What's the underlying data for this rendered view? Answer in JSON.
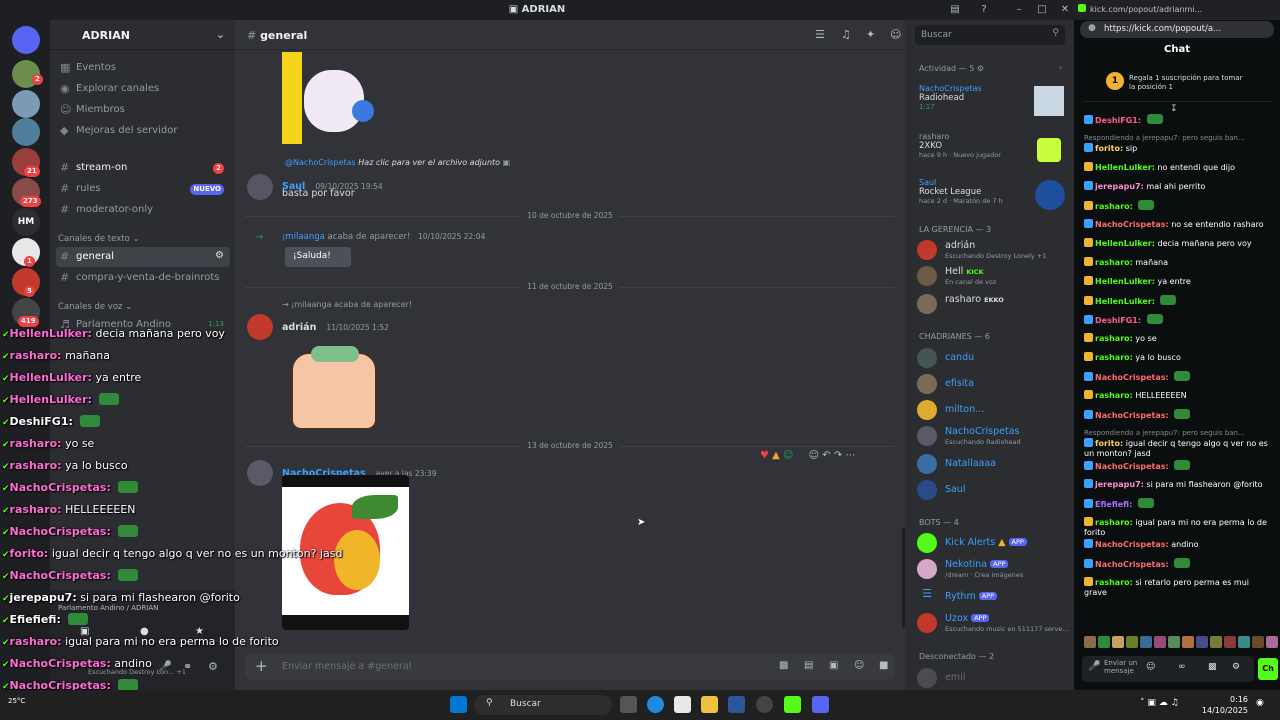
{
  "window": {
    "title": "ADRIAN"
  },
  "server": {
    "name": "ADRIAN"
  },
  "rail_badges": [
    "2",
    "21",
    "273",
    "HM",
    "1",
    "5",
    "419"
  ],
  "sidebar": {
    "top_items": [
      "Eventos",
      "Explorar canales",
      "Miembros",
      "Mejoras del servidor"
    ],
    "channels": [
      {
        "name": "stream-on",
        "badge": "2"
      },
      {
        "name": "rules",
        "badge": "NUEVO"
      },
      {
        "name": "moderator-only",
        "badge": ""
      }
    ],
    "text_category": "Canales de texto",
    "text_channels": [
      "general",
      "compra-y-venta-de-brainrots"
    ],
    "voice_category": "Canales de voz",
    "voice_channels": [
      "Parlamento Andino"
    ],
    "voice_time": "1:13"
  },
  "chat": {
    "channel": "general",
    "attachment_user": "@NachoCrispetas",
    "attachment_text": "Haz clic para ver el archivo adjunto",
    "msg1": {
      "author": "Saul",
      "time": "09/10/2025 19:54",
      "text": "basta por favor"
    },
    "div1": "10 de octubre de 2025",
    "join1": {
      "user": "¡milaanga",
      "text": "acaba de aparecer!",
      "time": "10/10/2025 22:04",
      "button": "¡Saluda!"
    },
    "div2": "11 de octubre de 2025",
    "join2": {
      "user": "¡milaanga",
      "text": "acaba de aparecer!"
    },
    "msg2": {
      "author": "adrián",
      "time": "11/10/2025 1:52"
    },
    "div3": "13 de octubre de 2025",
    "msg3": {
      "author": "NachoCrispetas",
      "time": "ayer a las 23:39"
    },
    "input_placeholder": "Enviar mensaje a #general"
  },
  "members": {
    "search_placeholder": "Buscar",
    "activity_header": "Actividad — 5",
    "activities": [
      {
        "user": "NachoCrispetas",
        "game": "Radiohead",
        "detail": "1:17"
      },
      {
        "user": "rasharo",
        "game": "2XKO",
        "detail": "hace 9 h · Nuevo jugador"
      },
      {
        "user": "Saul",
        "game": "Rocket League",
        "detail": "hace 2 d · Maratón de 7 h"
      }
    ],
    "group1": "LA GERENCIA — 3",
    "gerencia": [
      {
        "name": "adrián",
        "status": "Escuchando Destroy Lonely +1",
        "tag": "",
        "color": "#dbdee1"
      },
      {
        "name": "Hell",
        "status": "En canal de voz",
        "tag": "KICK",
        "color": "#dbdee1"
      },
      {
        "name": "rasharo",
        "status": "",
        "tag": "EKKO",
        "color": "#dbdee1"
      }
    ],
    "group2": "CHADRIANES — 6",
    "chadrianes": [
      {
        "name": "candu",
        "status": "",
        "color": "#3ba0ff"
      },
      {
        "name": "efisita",
        "status": "",
        "color": "#3ba0ff"
      },
      {
        "name": "milton...",
        "status": "",
        "color": "#3ba0ff"
      },
      {
        "name": "NachoCrispetas",
        "status": "Escuchando Radiohead",
        "color": "#3ba0ff"
      },
      {
        "name": "Natallaaaa",
        "status": "",
        "color": "#3ba0ff"
      },
      {
        "name": "Saul",
        "status": "",
        "color": "#3ba0ff"
      }
    ],
    "group3": "BOTS — 4",
    "bots": [
      {
        "name": "Kick Alerts",
        "status": "",
        "tag": "APP"
      },
      {
        "name": "Nekotina",
        "status": "/dream · Crea imágenes",
        "tag": "APP"
      },
      {
        "name": "Rythm",
        "status": "",
        "tag": "APP"
      },
      {
        "name": "Uzox",
        "status": "Escuchando music en 511177 serve...",
        "tag": "APP"
      }
    ],
    "group4": "Desconectado — 2",
    "offline": [
      "emil"
    ]
  },
  "kick": {
    "tab": "kick.com/popout/adrianmi...",
    "url": "https://kick.com/popout/a...",
    "chat_title": "Chat",
    "sub_banner": "Regala 1 suscripción para tomar la posición 1",
    "sub_rank": "1",
    "messages": [
      {
        "u": "DeshiFG1:",
        "t": "",
        "c": "#ff5c8a",
        "reply": ""
      },
      {
        "u": "forito:",
        "t": "sip",
        "c": "#ffd35b",
        "reply": "Respondiendo a jerepapu7: pero seguis ban..."
      },
      {
        "u": "HellenLulker:",
        "t": "no entendi que dijo",
        "c": "#53fc18",
        "reply": ""
      },
      {
        "u": "jerepapu7:",
        "t": "mal ahi perrito",
        "c": "#ff8cd1",
        "reply": ""
      },
      {
        "u": "rasharo:",
        "t": "",
        "c": "#53fc18",
        "reply": ""
      },
      {
        "u": "NachoCrispetas:",
        "t": "no se entendio rasharo",
        "c": "#ff6b6b",
        "reply": ""
      },
      {
        "u": "HellenLulker:",
        "t": "decia mañana pero voy",
        "c": "#53fc18",
        "reply": ""
      },
      {
        "u": "rasharo:",
        "t": "mañana",
        "c": "#53fc18",
        "reply": ""
      },
      {
        "u": "HellenLulker:",
        "t": "ya entre",
        "c": "#53fc18",
        "reply": ""
      },
      {
        "u": "HellenLulker:",
        "t": "",
        "c": "#53fc18",
        "reply": ""
      },
      {
        "u": "DeshiFG1:",
        "t": "",
        "c": "#ff5c8a",
        "reply": ""
      },
      {
        "u": "rasharo:",
        "t": "yo se",
        "c": "#53fc18",
        "reply": ""
      },
      {
        "u": "rasharo:",
        "t": "ya lo busco",
        "c": "#53fc18",
        "reply": ""
      },
      {
        "u": "NachoCrispetas:",
        "t": "",
        "c": "#ff6b6b",
        "reply": ""
      },
      {
        "u": "rasharo:",
        "t": "HELLEEEEEN",
        "c": "#53fc18",
        "reply": ""
      },
      {
        "u": "NachoCrispetas:",
        "t": "",
        "c": "#ff6b6b",
        "reply": ""
      },
      {
        "u": "forito:",
        "t": "igual decir q tengo algo q ver no es un monton? jasd",
        "c": "#ffd35b",
        "reply": "Respondiendo a jerepapu7: pero seguis ban..."
      },
      {
        "u": "NachoCrispetas:",
        "t": "",
        "c": "#ff6b6b",
        "reply": ""
      },
      {
        "u": "jerepapu7:",
        "t": "si para mi flashearon @forito",
        "c": "#ff8cd1",
        "reply": ""
      },
      {
        "u": "Efiefiefi:",
        "t": "",
        "c": "#a970ff",
        "reply": ""
      },
      {
        "u": "rasharo:",
        "t": "igual para mi no era perma lo de forito",
        "c": "#53fc18",
        "reply": ""
      },
      {
        "u": "NachoCrispetas:",
        "t": "andino",
        "c": "#ff6b6b",
        "reply": ""
      },
      {
        "u": "NachoCrispetas:",
        "t": "",
        "c": "#ff6b6b",
        "reply": ""
      },
      {
        "u": "rasharo:",
        "t": "si retarlo pero perma es mui grave",
        "c": "#53fc18",
        "reply": ""
      }
    ],
    "send_placeholder": "Enviar un mensaje",
    "send_label": "Ch"
  },
  "overlay": [
    {
      "u": "HellenLulker:",
      "t": "decia mañana pero voy",
      "c": "#ff6bd6"
    },
    {
      "u": "rasharo:",
      "t": "mañana",
      "c": "#ff6bd6"
    },
    {
      "u": "HellenLulker:",
      "t": "ya entre",
      "c": "#ff6bd6"
    },
    {
      "u": "HellenLulker:",
      "t": "",
      "c": "#ff6bd6"
    },
    {
      "u": "DeshiFG1:",
      "t": "",
      "c": "#ffffff"
    },
    {
      "u": "rasharo:",
      "t": "yo se",
      "c": "#ff6bd6"
    },
    {
      "u": "rasharo:",
      "t": "ya lo busco",
      "c": "#ff6bd6"
    },
    {
      "u": "NachoCrispetas:",
      "t": "",
      "c": "#ff6bd6"
    },
    {
      "u": "rasharo:",
      "t": "HELLEEEEEN",
      "c": "#ff6bd6"
    },
    {
      "u": "NachoCrispetas:",
      "t": "",
      "c": "#ff6bd6"
    },
    {
      "u": "forito:",
      "t": "igual decir q tengo algo q ver no es un monton? jasd",
      "c": "#ff6bd6"
    },
    {
      "u": "NachoCrispetas:",
      "t": "",
      "c": "#ff6bd6"
    },
    {
      "u": "jerepapu7:",
      "t": "si para mi flashearon @forito",
      "c": "#ffffff"
    },
    {
      "u": "Efiefiefi:",
      "t": "",
      "c": "#ffffff"
    },
    {
      "u": "rasharo:",
      "t": "igual para mi no era perma lo de forito",
      "c": "#ff6bd6"
    },
    {
      "u": "NachoCrispetas:",
      "t": "andino",
      "c": "#ff6bd6"
    },
    {
      "u": "NachoCrispetas:",
      "t": "",
      "c": "#ff6bd6"
    },
    {
      "u": "rasharo:",
      "t": "si retarlo pero perma es mui grave",
      "c": "#ff6bd6"
    }
  ],
  "voice_panel": {
    "channel": "Parlamento Andino / ADRIAN",
    "user_status": "Escuchando Destroy Lon... +1"
  },
  "taskbar": {
    "search": "Buscar",
    "time": "0:16",
    "date": "14/10/2025",
    "weather": "25°C"
  }
}
